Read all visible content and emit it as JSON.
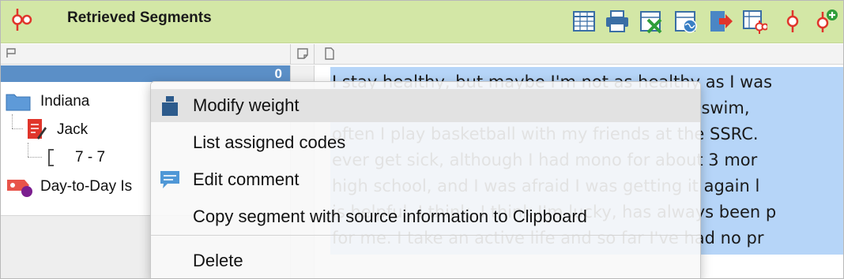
{
  "header": {
    "title": "Retrieved Segments",
    "toolbar": [
      {
        "name": "table-view-icon"
      },
      {
        "name": "print-icon"
      },
      {
        "name": "export-excel-icon"
      },
      {
        "name": "export-html-icon"
      },
      {
        "name": "export-arrow-icon"
      },
      {
        "name": "table-codes-icon"
      },
      {
        "name": "code-pin-icon"
      },
      {
        "name": "add-code-pin-icon"
      }
    ]
  },
  "left_panel": {
    "selected_count": "0",
    "tree": [
      {
        "label": "Indiana",
        "icon": "folder-icon"
      },
      {
        "label": "Jack",
        "icon": "document-icon"
      },
      {
        "label": "7 - 7",
        "icon": "segment-bracket-icon"
      },
      {
        "label": "Day-to-Day Is",
        "icon": "code-tag-icon"
      }
    ]
  },
  "document": {
    "lines": [
      "I stay healthy, but maybe I'm not as healthy as I was",
      "school when I swam almost every day.  I still swim,",
      "often I play basketball with my friends at the SSRC.",
      "ever get sick, although I had mono for about 3 mor",
      "high school, and I was afraid I was getting it again l",
      "is helpful, I think. I think I'm lucky, has always been p",
      "for me. I take an active life and so far I've had no pr"
    ]
  },
  "context_menu": {
    "items": [
      {
        "label": "Modify weight",
        "icon": "weight-icon"
      },
      {
        "label": "List assigned codes",
        "icon": ""
      },
      {
        "label": "Edit comment",
        "icon": "comment-icon"
      },
      {
        "label": "Copy segment with source information to Clipboard",
        "icon": ""
      },
      {
        "label": "Delete",
        "icon": ""
      }
    ]
  },
  "colors": {
    "header_bg": "#d3e7a6",
    "selection_blue": "#5b8fc7",
    "text_highlight": "#b6d5f8",
    "code_red": "#e0352b"
  }
}
